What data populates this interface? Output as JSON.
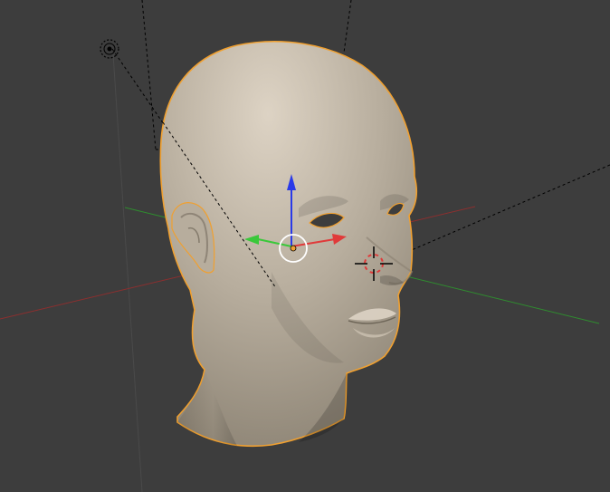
{
  "viewport": {
    "mode": "3d-viewport",
    "background": "#3d3d3d",
    "grid_line_color": "#4a4a4a"
  },
  "axes": {
    "x_axis_color": "#8c2f2f",
    "y_axis_color": "#2f8c2f"
  },
  "object": {
    "type": "head-mesh",
    "selected": true,
    "outline_color": "#f0a030",
    "skin_color_light": "#ddd3c4",
    "skin_color_mid": "#b7ad9d",
    "skin_color_dark": "#8a8172"
  },
  "gizmo": {
    "x_color": "#e03a3a",
    "y_color": "#3ac83a",
    "z_color": "#2a3ae8",
    "center_color": "#ffffff"
  },
  "helpers": {
    "lamp_icon": "lamp-icon",
    "camera_outline_style": "dashed",
    "cursor_icon": "3d-cursor-icon",
    "cursor_colors": [
      "#ffffff",
      "#e03a3a"
    ]
  }
}
